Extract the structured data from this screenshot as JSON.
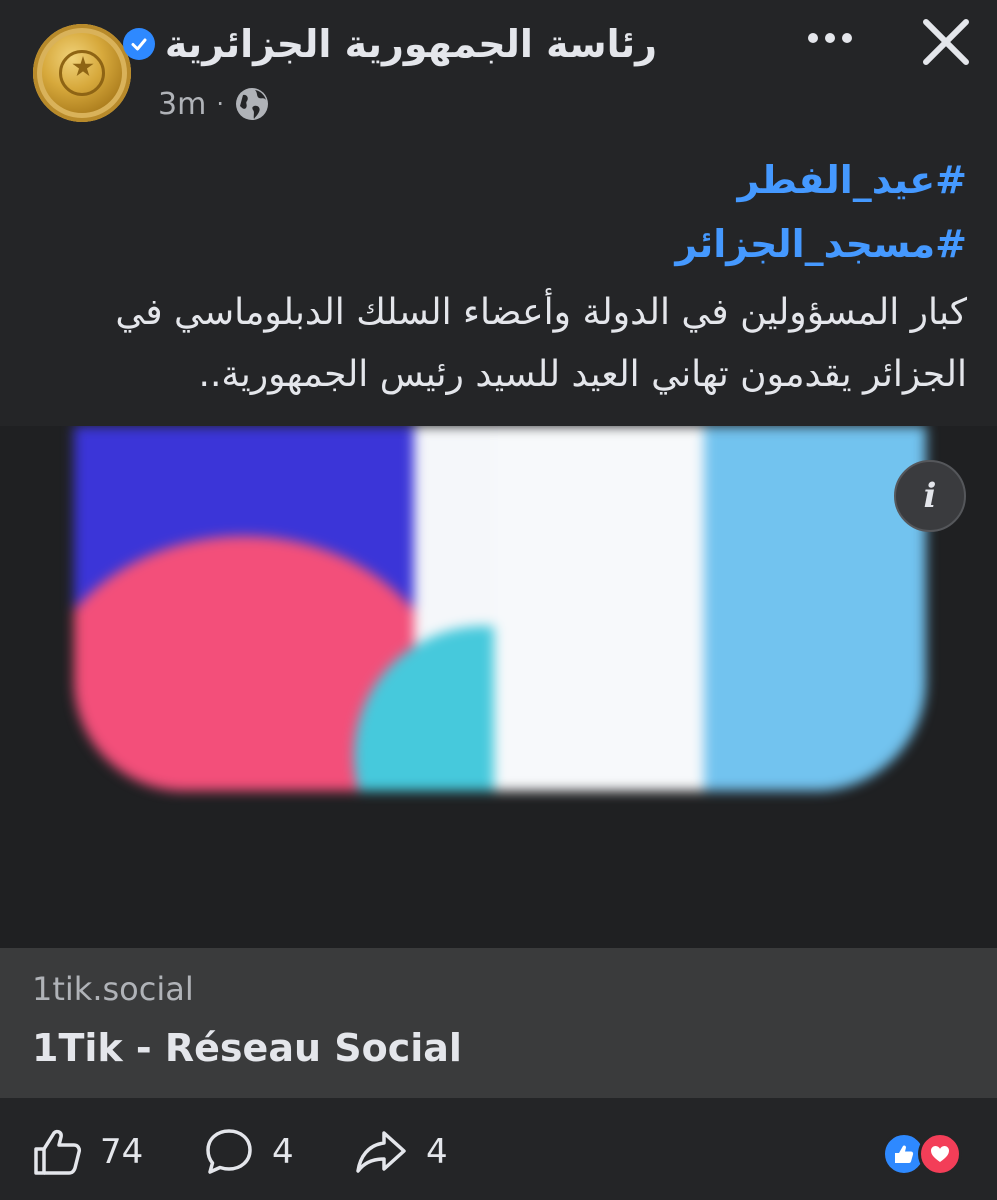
{
  "header": {
    "page_name": "رئاسة الجمهورية الجزائرية",
    "time": "3m",
    "separator": "·"
  },
  "post": {
    "hashtags": [
      "#عيد_الفطر",
      "#مسجد_الجزائر"
    ],
    "message": "كبار المسؤولين في الدولة وأعضاء السلك الدبلوماسي في الجزائر يقدمون تهاني العيد للسيد رئيس الجمهورية.."
  },
  "media": {
    "info_label": "i"
  },
  "link_preview": {
    "domain": "1tik.social",
    "title": "1Tik - Réseau Social"
  },
  "actions": {
    "likes": "74",
    "comments": "4",
    "shares": "4"
  },
  "icons": {
    "close": "close-icon",
    "more": "more-dots-icon",
    "verified": "verified-badge-icon",
    "privacy": "globe-icon",
    "like": "thumbs-up-icon",
    "comment": "comment-bubble-icon",
    "share": "share-arrow-icon",
    "reaction_like": "like-reaction-icon",
    "reaction_love": "love-reaction-icon"
  },
  "colors": {
    "background": "#242527",
    "accent": "#2e89ff",
    "hashtag": "#4599ff",
    "love": "#f33e58",
    "link_bg": "#3a3b3c"
  }
}
